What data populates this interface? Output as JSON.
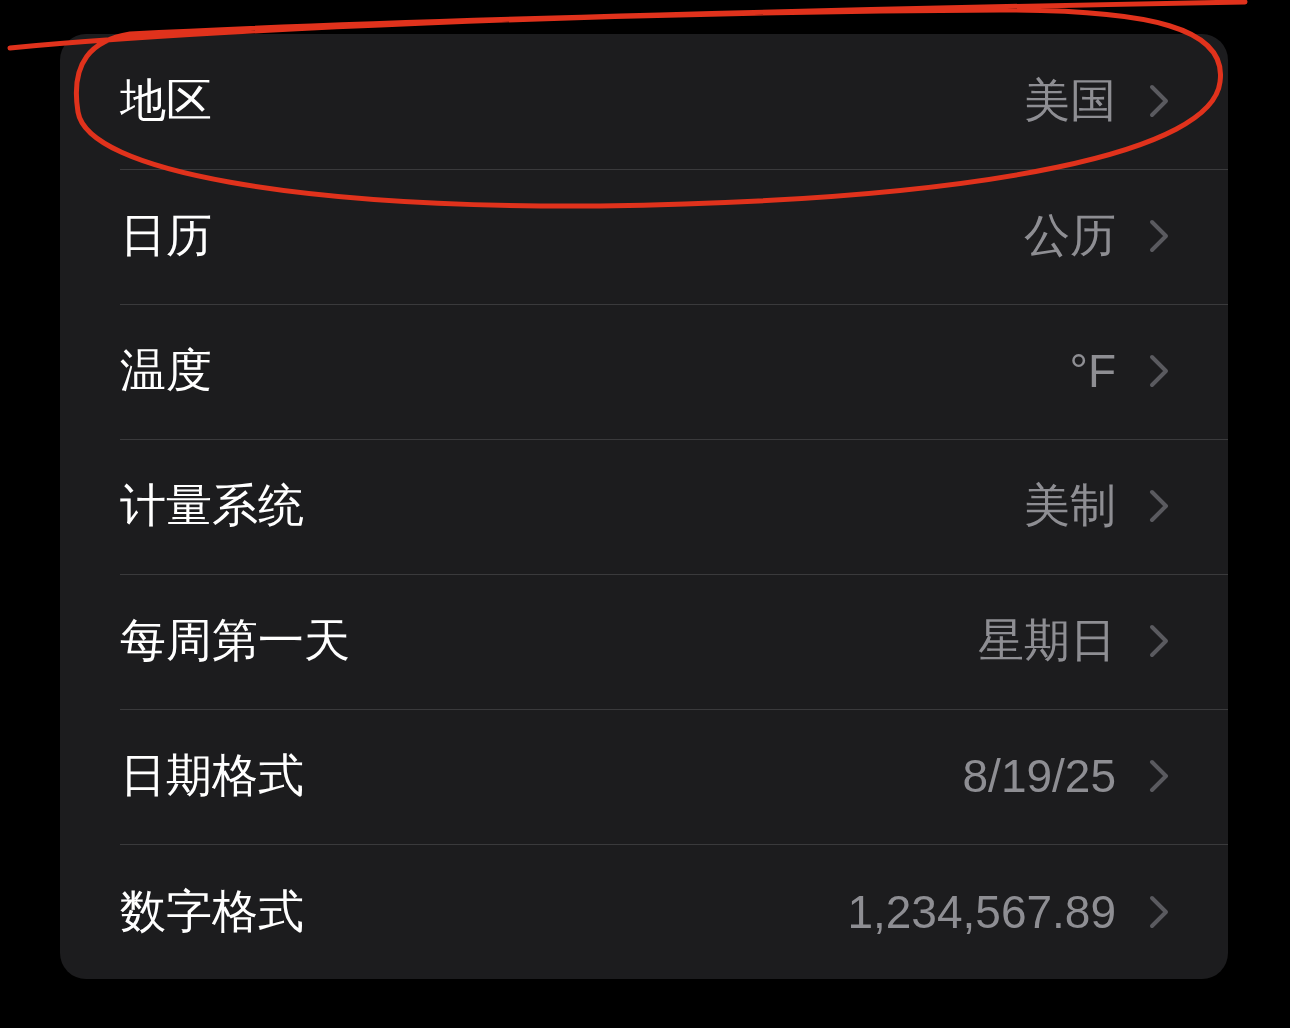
{
  "rows": [
    {
      "label": "地区",
      "value": "美国",
      "circled": true
    },
    {
      "label": "日历",
      "value": "公历",
      "circled": false
    },
    {
      "label": "温度",
      "value": "°F",
      "circled": false
    },
    {
      "label": "计量系统",
      "value": "美制",
      "circled": false
    },
    {
      "label": "每周第一天",
      "value": "星期日",
      "circled": false
    },
    {
      "label": "日期格式",
      "value": "8/19/25",
      "circled": false
    },
    {
      "label": "数字格式",
      "value": "1,234,567.89",
      "circled": false
    }
  ]
}
